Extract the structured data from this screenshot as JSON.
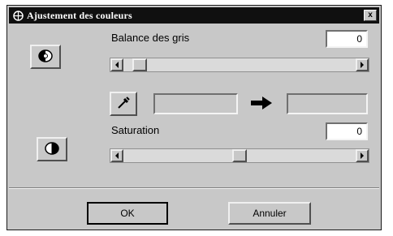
{
  "dialog": {
    "title": "Ajustement des couleurs",
    "close_label": "x"
  },
  "gray_balance": {
    "label": "Balance des gris",
    "value": "0",
    "slider_fraction": 0.04
  },
  "saturation": {
    "label": "Saturation",
    "value": "0",
    "slider_fraction": 0.5
  },
  "buttons": {
    "ok": "OK",
    "cancel": "Annuler"
  },
  "icons": {
    "title": "color-palette-icon",
    "gray_balance": "gray-balance-icon",
    "saturation": "saturation-icon",
    "eyedropper": "eyedropper-icon",
    "arrow": "arrow-right-icon"
  }
}
